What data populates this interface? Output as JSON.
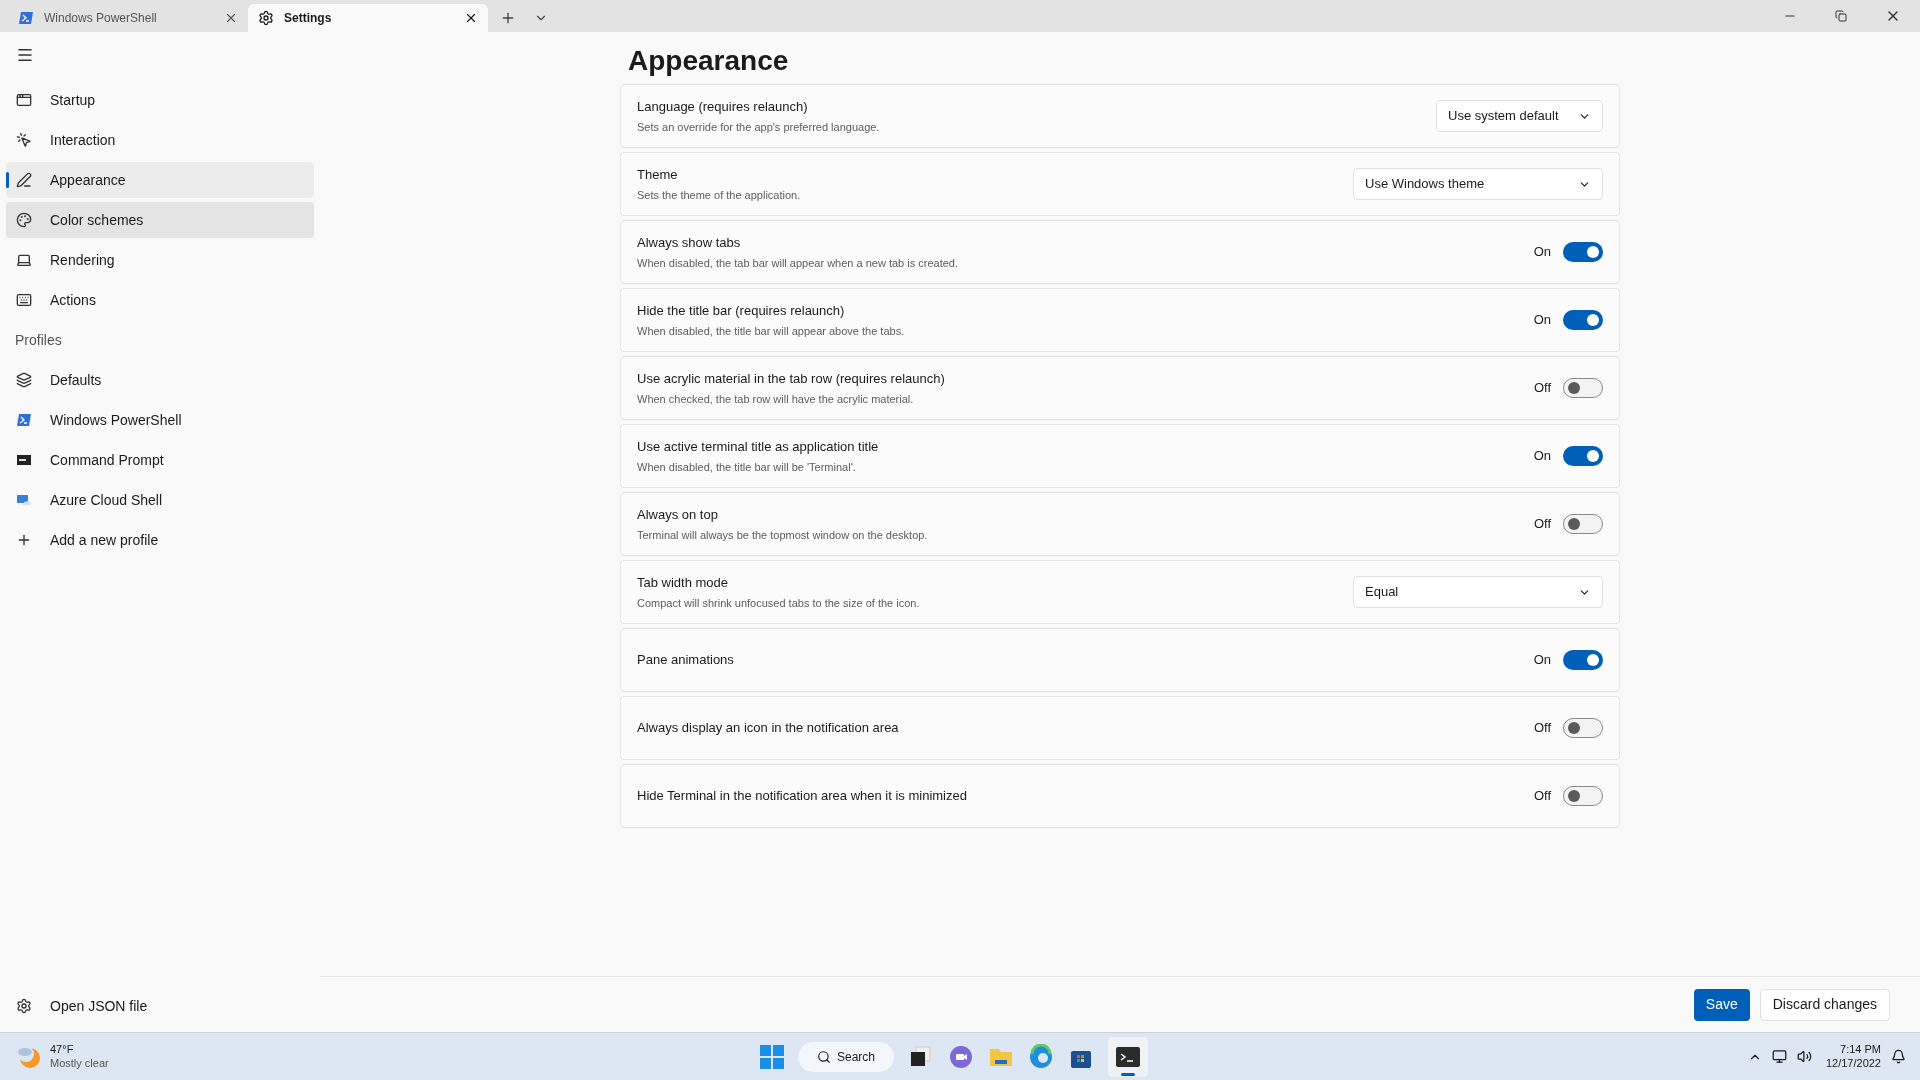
{
  "tabs": [
    {
      "title": "Windows PowerShell",
      "selected": false
    },
    {
      "title": "Settings",
      "selected": true
    }
  ],
  "sidebar": {
    "items": [
      {
        "label": "Startup",
        "selected": false,
        "hovered": false
      },
      {
        "label": "Interaction",
        "selected": false,
        "hovered": false
      },
      {
        "label": "Appearance",
        "selected": true,
        "hovered": false
      },
      {
        "label": "Color schemes",
        "selected": false,
        "hovered": true
      },
      {
        "label": "Rendering",
        "selected": false,
        "hovered": false
      },
      {
        "label": "Actions",
        "selected": false,
        "hovered": false
      }
    ],
    "profiles_heading": "Profiles",
    "profiles": [
      {
        "label": "Defaults"
      },
      {
        "label": "Windows PowerShell"
      },
      {
        "label": "Command Prompt"
      },
      {
        "label": "Azure Cloud Shell"
      },
      {
        "label": "Add a new profile"
      }
    ],
    "footer_item": "Open JSON file"
  },
  "page_title": "Appearance",
  "settings": [
    {
      "kind": "dropdown",
      "label": "Language (requires relaunch)",
      "description": "Sets an override for the app's preferred language.",
      "value": "Use system default"
    },
    {
      "kind": "dropdown",
      "label": "Theme",
      "description": "Sets the theme of the application.",
      "value": "Use Windows theme"
    },
    {
      "kind": "toggle",
      "label": "Always show tabs",
      "description": "When disabled, the tab bar will appear when a new tab is created.",
      "on": true,
      "state_label": "On"
    },
    {
      "kind": "toggle",
      "label": "Hide the title bar (requires relaunch)",
      "description": "When disabled, the title bar will appear above the tabs.",
      "on": true,
      "state_label": "On"
    },
    {
      "kind": "toggle",
      "label": "Use acrylic material in the tab row (requires relaunch)",
      "description": "When checked, the tab row will have the acrylic material.",
      "on": false,
      "state_label": "Off"
    },
    {
      "kind": "toggle",
      "label": "Use active terminal title as application title",
      "description": "When disabled, the title bar will be 'Terminal'.",
      "on": true,
      "state_label": "On"
    },
    {
      "kind": "toggle",
      "label": "Always on top",
      "description": "Terminal will always be the topmost window on the desktop.",
      "on": false,
      "state_label": "Off"
    },
    {
      "kind": "dropdown",
      "label": "Tab width mode",
      "description": "Compact will shrink unfocused tabs to the size of the icon.",
      "value": "Equal"
    },
    {
      "kind": "toggle",
      "label": "Pane animations",
      "on": true,
      "state_label": "On"
    },
    {
      "kind": "toggle",
      "label": "Always display an icon in the notification area",
      "on": false,
      "state_label": "Off"
    },
    {
      "kind": "toggle",
      "label": "Hide Terminal in the notification area when it is minimized",
      "on": false,
      "state_label": "Off"
    }
  ],
  "buttons": {
    "save": "Save",
    "discard": "Discard changes"
  },
  "taskbar": {
    "temperature": "47°F",
    "weather": "Mostly clear",
    "search": "Search",
    "time": "7:14 PM",
    "date": "12/17/2022"
  }
}
